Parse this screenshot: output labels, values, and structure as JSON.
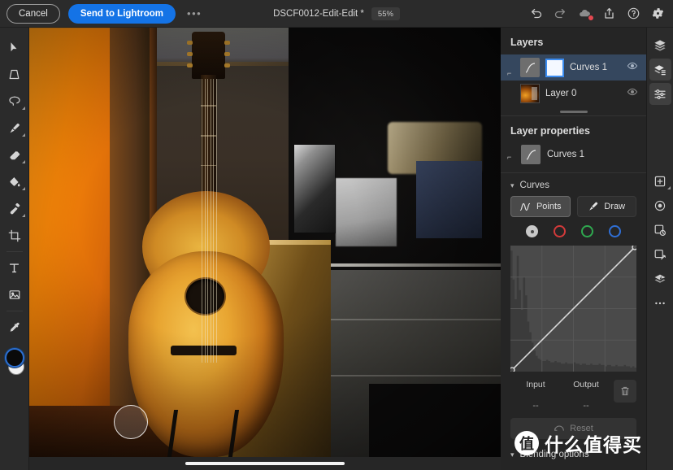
{
  "topbar": {
    "cancel_label": "Cancel",
    "send_label": "Send to Lightroom",
    "more_label": "•••",
    "doc_title": "DSCF0012-Edit-Edit *",
    "zoom_level": "55%",
    "icons": [
      "undo-icon",
      "redo-icon",
      "cloud-error-icon",
      "share-icon",
      "help-icon",
      "settings-icon"
    ]
  },
  "tools": [
    {
      "name": "move-tool",
      "icon": "cursor-arrow-icon",
      "has_flyout": false
    },
    {
      "name": "transform-tool",
      "icon": "transform-icon",
      "has_flyout": false
    },
    {
      "name": "lasso-tool",
      "icon": "lasso-icon",
      "has_flyout": true
    },
    {
      "name": "brush-tool",
      "icon": "paintbrush-icon",
      "has_flyout": true
    },
    {
      "name": "eraser-tool",
      "icon": "eraser-icon",
      "has_flyout": true
    },
    {
      "name": "fill-tool",
      "icon": "paint-bucket-icon",
      "has_flyout": true
    },
    {
      "name": "clone-tool",
      "icon": "clone-stamp-icon",
      "has_flyout": true
    },
    {
      "name": "crop-tool",
      "icon": "crop-icon",
      "has_flyout": false
    },
    {
      "name": "text-tool",
      "icon": "text-t-icon",
      "has_flyout": false
    },
    {
      "name": "place-image-tool",
      "icon": "image-icon",
      "has_flyout": false
    },
    {
      "name": "eyedropper-tool",
      "icon": "eyedropper-icon",
      "has_flyout": false
    }
  ],
  "layers_panel": {
    "title": "Layers",
    "layers": [
      {
        "name": "Curves 1",
        "selected": true,
        "type": "adjustment",
        "mask_selected": true,
        "visibility_icon": "eye-icon"
      },
      {
        "name": "Layer 0",
        "selected": false,
        "type": "pixel",
        "mask_selected": false,
        "visibility_icon": "eye-icon"
      }
    ]
  },
  "layer_properties": {
    "title": "Layer properties",
    "layer_name": "Curves 1"
  },
  "curves": {
    "section_title": "Curves",
    "mode_points": "Points",
    "mode_draw": "Draw",
    "active_mode": "Points",
    "channels": [
      {
        "name": "master-channel",
        "color": "#c9c9c9",
        "selected": true
      },
      {
        "name": "red-channel",
        "color": "#d33a3a",
        "selected": false
      },
      {
        "name": "green-channel",
        "color": "#2fa84f",
        "selected": false
      },
      {
        "name": "blue-channel",
        "color": "#2f6fd6",
        "selected": false
      }
    ],
    "input_label": "Input",
    "output_label": "Output",
    "input_value": "--",
    "output_value": "--",
    "reset_label": "Reset",
    "delete_icon": "trash-icon"
  },
  "blending": {
    "title": "Blending options"
  },
  "right_rail": [
    {
      "name": "layers-stack-icon",
      "active": false
    },
    {
      "name": "layers-list-icon",
      "active": true
    },
    {
      "name": "adjustments-sliders-icon",
      "active": true
    },
    {
      "name": "add-layer-icon",
      "active": false,
      "has_flyout": true
    },
    {
      "name": "visibility-eye-icon",
      "active": false
    },
    {
      "name": "mask-icon",
      "active": false
    },
    {
      "name": "link-layers-icon",
      "active": false
    },
    {
      "name": "effects-icon",
      "active": false
    },
    {
      "name": "more-options-icon",
      "active": false
    }
  ],
  "watermark": {
    "logo_char": "值",
    "text": "什么值得买"
  },
  "chart_data": {
    "type": "line",
    "title": "Curves",
    "xlabel": "Input",
    "ylabel": "Output",
    "xlim": [
      0,
      255
    ],
    "ylim": [
      0,
      255
    ],
    "grid": true,
    "control_points": [
      [
        0,
        0
      ],
      [
        255,
        255
      ]
    ],
    "histogram": [
      92,
      70,
      55,
      88,
      62,
      47,
      72,
      58,
      38,
      30,
      22,
      16,
      12,
      10,
      9,
      8,
      8,
      9,
      8,
      7,
      7,
      8,
      7,
      7,
      6,
      6,
      7,
      6,
      6,
      6,
      7,
      6,
      6,
      5,
      6,
      6,
      5,
      5,
      6,
      5,
      5,
      5,
      6,
      5,
      5,
      4,
      5,
      5,
      4,
      4,
      5,
      4,
      4,
      4,
      5,
      4,
      4,
      3,
      4,
      3
    ]
  }
}
